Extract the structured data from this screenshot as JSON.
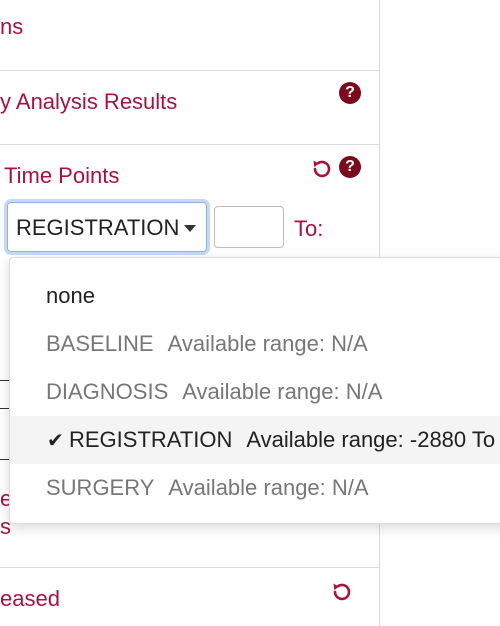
{
  "sections": {
    "s1_title": "ns",
    "s2_title": "y Analysis Results",
    "s3_title": "Time Points",
    "s4_partial": "e",
    "s4_partial2": "s",
    "s5_title": "eased"
  },
  "time_points": {
    "selected_value": "REGISTRATION",
    "to_label": "To:",
    "to_input_value": ""
  },
  "dropdown": {
    "options": [
      {
        "name": "none",
        "range": ""
      },
      {
        "name": "BASELINE",
        "range": "Available range: N/A"
      },
      {
        "name": "DIAGNOSIS",
        "range": "Available range: N/A"
      },
      {
        "name": "REGISTRATION",
        "range": "Available range: -2880 To"
      },
      {
        "name": "SURGERY",
        "range": "Available range: N/A"
      }
    ],
    "check_glyph": "✔"
  },
  "icons": {
    "help": "?",
    "accent_color": "#a8123e",
    "icon_dark": "#7a0a1c"
  }
}
